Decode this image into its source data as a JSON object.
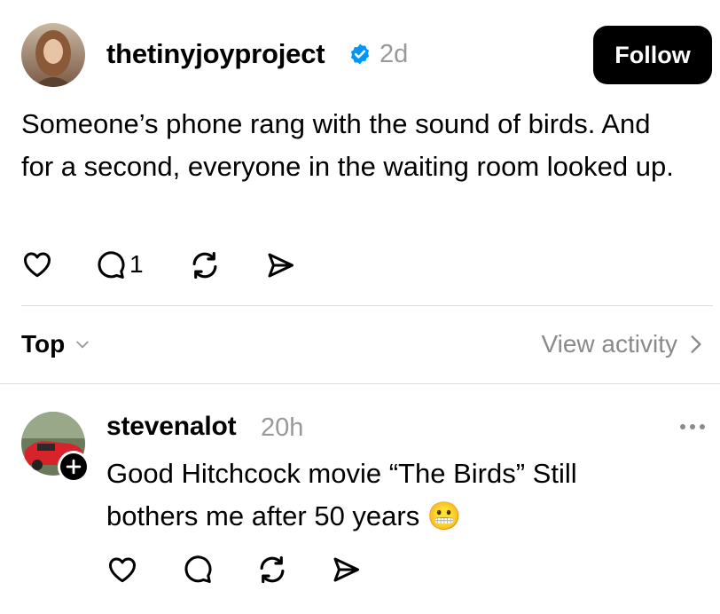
{
  "post": {
    "username": "thetinyjoyproject",
    "verified": true,
    "time": "2d",
    "follow_label": "Follow",
    "text": "Someone’s phone rang with the sound of birds. And for a second, everyone in the waiting room looked up.",
    "reply_count": "1",
    "icons": [
      "heart-icon",
      "comment-icon",
      "repost-icon",
      "share-icon"
    ]
  },
  "filter_bar": {
    "sort_label": "Top",
    "view_activity_label": "View activity"
  },
  "reply": {
    "username": "stevenalot",
    "time": "20h",
    "text": "Good Hitchcock movie “The Birds” Still bothers me after 50 years 😬",
    "icons": [
      "heart-icon",
      "comment-icon",
      "repost-icon",
      "share-icon",
      "more-icon",
      "plus-icon"
    ]
  },
  "colors": {
    "verified": "#0095f6",
    "muted": "#999999",
    "button": "#000000"
  }
}
